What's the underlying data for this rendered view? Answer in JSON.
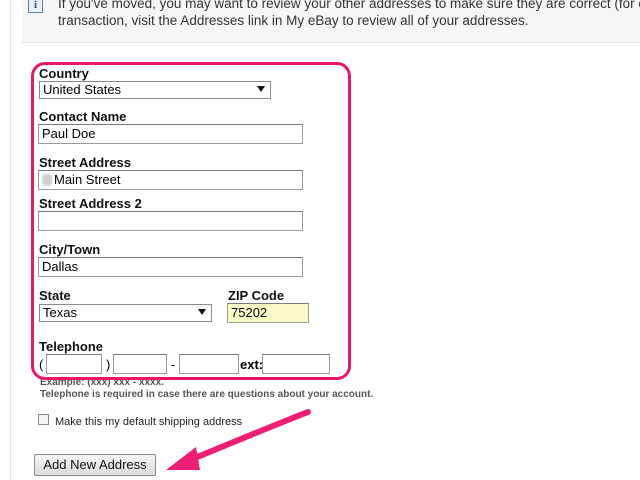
{
  "info": {
    "line1": "If you've moved, you may want to review your other addresses to make sure they are correct (for exa",
    "line2": "transaction, visit the Addresses link in My eBay to review all of your addresses."
  },
  "form": {
    "country_label": "Country",
    "country_value": "United States",
    "contact_label": "Contact Name",
    "contact_value": "Paul Doe",
    "street_label": "Street Address",
    "street_value": "Main Street",
    "street2_label": "Street Address 2",
    "street2_value": "",
    "city_label": "City/Town",
    "city_value": "Dallas",
    "state_label": "State",
    "state_value": "Texas",
    "zip_label": "ZIP Code",
    "zip_value": "75202",
    "phone_label": "Telephone",
    "phone_open": "(",
    "phone_close": ")",
    "phone_dash": "-",
    "phone_ext": "ext:",
    "phone_area": "",
    "phone_prefix": "",
    "phone_line": "",
    "phone_extension": "",
    "phone_example": "Example: (xxx) xxx - xxxx.",
    "phone_note": "Telephone is required in case there are questions about your account."
  },
  "default_checkbox": {
    "label": "Make this my default shipping address",
    "checked": false
  },
  "submit": {
    "label": "Add New Address"
  },
  "annotation": {
    "highlight_color": "#e8176a",
    "arrow_color": "#ee1e74"
  }
}
